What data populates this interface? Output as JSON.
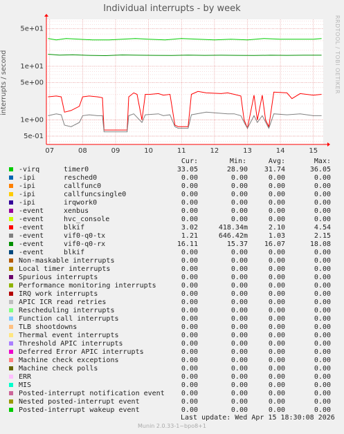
{
  "title": "Individual interrupts - by week",
  "side_credit": "RRDTOOL / TOBI OETIKER",
  "ylabel": "interrupts / second",
  "colors": {
    "axis_red": "#ff0000",
    "grid": "#e8a0a0",
    "background": "#f0f0f0",
    "plot_bg": "#ffffff"
  },
  "headers": {
    "cur": "Cur:",
    "min": "Min:",
    "avg": "Avg:",
    "max": "Max:"
  },
  "legend": [
    {
      "type": "-virq",
      "name": "timer0",
      "color": "#00cc00",
      "cur": "33.05",
      "min": "28.90",
      "avg": "31.74",
      "max": "36.05"
    },
    {
      "type": "-ipi",
      "name": "resched0",
      "color": "#0066b3",
      "cur": "0.00",
      "min": "0.00",
      "avg": "0.00",
      "max": "0.00"
    },
    {
      "type": "-ipi",
      "name": "callfunc0",
      "color": "#ff8000",
      "cur": "0.00",
      "min": "0.00",
      "avg": "0.00",
      "max": "0.00"
    },
    {
      "type": "-ipi",
      "name": "callfuncsingle0",
      "color": "#ffcc00",
      "cur": "0.00",
      "min": "0.00",
      "avg": "0.00",
      "max": "0.00"
    },
    {
      "type": "-ipi",
      "name": "irqwork0",
      "color": "#330099",
      "cur": "0.00",
      "min": "0.00",
      "avg": "0.00",
      "max": "0.00"
    },
    {
      "type": "-event",
      "name": "xenbus",
      "color": "#990099",
      "cur": "0.00",
      "min": "0.00",
      "avg": "0.00",
      "max": "0.00"
    },
    {
      "type": "-event",
      "name": "hvc_console",
      "color": "#ccff00",
      "cur": "0.00",
      "min": "0.00",
      "avg": "0.00",
      "max": "0.00"
    },
    {
      "type": "-event",
      "name": "blkif",
      "color": "#ff0000",
      "cur": "3.02",
      "min": "418.34m",
      "avg": "2.10",
      "max": "4.54"
    },
    {
      "type": "-event",
      "name": "vif0-q0-tx",
      "color": "#808080",
      "cur": "1.21",
      "min": "646.42m",
      "avg": "1.03",
      "max": "2.15"
    },
    {
      "type": "-event",
      "name": "vif0-q0-rx",
      "color": "#008f00",
      "cur": "16.11",
      "min": "15.37",
      "avg": "16.07",
      "max": "18.08"
    },
    {
      "type": "-event",
      "name": "blkif",
      "color": "#00487d",
      "cur": "0.00",
      "min": "0.00",
      "avg": "0.00",
      "max": "0.00"
    },
    {
      "type": "",
      "name": "Non-maskable interrupts",
      "color": "#b35a00",
      "cur": "0.00",
      "min": "0.00",
      "avg": "0.00",
      "max": "0.00"
    },
    {
      "type": "",
      "name": "Local timer interrupts",
      "color": "#b38f00",
      "cur": "0.00",
      "min": "0.00",
      "avg": "0.00",
      "max": "0.00"
    },
    {
      "type": "",
      "name": "Spurious interrupts",
      "color": "#6b006b",
      "cur": "0.00",
      "min": "0.00",
      "avg": "0.00",
      "max": "0.00"
    },
    {
      "type": "",
      "name": "Performance monitoring interrupts",
      "color": "#8fb300",
      "cur": "0.00",
      "min": "0.00",
      "avg": "0.00",
      "max": "0.00"
    },
    {
      "type": "",
      "name": "IRQ work interrupts",
      "color": "#b30000",
      "cur": "0.00",
      "min": "0.00",
      "avg": "0.00",
      "max": "0.00"
    },
    {
      "type": "",
      "name": "APIC ICR read retries",
      "color": "#bebebe",
      "cur": "0.00",
      "min": "0.00",
      "avg": "0.00",
      "max": "0.00"
    },
    {
      "type": "",
      "name": "Rescheduling interrupts",
      "color": "#80ff80",
      "cur": "0.00",
      "min": "0.00",
      "avg": "0.00",
      "max": "0.00"
    },
    {
      "type": "",
      "name": "Function call interrupts",
      "color": "#80c9ff",
      "cur": "0.00",
      "min": "0.00",
      "avg": "0.00",
      "max": "0.00"
    },
    {
      "type": "",
      "name": "TLB shootdowns",
      "color": "#ffc080",
      "cur": "0.00",
      "min": "0.00",
      "avg": "0.00",
      "max": "0.00"
    },
    {
      "type": "",
      "name": "Thermal event interrupts",
      "color": "#ffe680",
      "cur": "0.00",
      "min": "0.00",
      "avg": "0.00",
      "max": "0.00"
    },
    {
      "type": "",
      "name": "Threshold APIC interrupts",
      "color": "#aa80ff",
      "cur": "0.00",
      "min": "0.00",
      "avg": "0.00",
      "max": "0.00"
    },
    {
      "type": "",
      "name": "Deferred Error APIC interrupts",
      "color": "#ee00cc",
      "cur": "0.00",
      "min": "0.00",
      "avg": "0.00",
      "max": "0.00"
    },
    {
      "type": "",
      "name": "Machine check exceptions",
      "color": "#ff8080",
      "cur": "0.00",
      "min": "0.00",
      "avg": "0.00",
      "max": "0.00"
    },
    {
      "type": "",
      "name": "Machine check polls",
      "color": "#666600",
      "cur": "0.00",
      "min": "0.00",
      "avg": "0.00",
      "max": "0.00"
    },
    {
      "type": "",
      "name": "ERR",
      "color": "#ffbfff",
      "cur": "0.00",
      "min": "0.00",
      "avg": "0.00",
      "max": "0.00"
    },
    {
      "type": "",
      "name": "MIS",
      "color": "#00ffcc",
      "cur": "0.00",
      "min": "0.00",
      "avg": "0.00",
      "max": "0.00"
    },
    {
      "type": "",
      "name": "Posted-interrupt notification event",
      "color": "#cc6699",
      "cur": "0.00",
      "min": "0.00",
      "avg": "0.00",
      "max": "0.00"
    },
    {
      "type": "",
      "name": "Nested posted-interrupt event",
      "color": "#999900",
      "cur": "0.00",
      "min": "0.00",
      "avg": "0.00",
      "max": "0.00"
    },
    {
      "type": "",
      "name": "Posted-interrupt wakeup event",
      "color": "#00cc00",
      "cur": "0.00",
      "min": "0.00",
      "avg": "0.00",
      "max": "0.00"
    }
  ],
  "last_update": "Last update: Wed Apr 15 18:30:08 2026",
  "munin_version": "Munin 2.0.33-1~bpo8+1",
  "chart_data": {
    "type": "line",
    "yscale": "log",
    "ylim": [
      0.35,
      75
    ],
    "xlim": [
      6.9,
      15.3
    ],
    "xlabel": "",
    "ylabel": "interrupts / second",
    "x_ticks": [
      7,
      8,
      9,
      10,
      11,
      12,
      13,
      14,
      15
    ],
    "x_tick_labels": [
      "07",
      "08",
      "09",
      "10",
      "11",
      "12",
      "13",
      "14",
      "15"
    ],
    "y_ticks": [
      0.5,
      1,
      5,
      10,
      50
    ],
    "y_tick_labels": [
      "5e-01",
      "1e+00",
      "5e+00",
      "1e+01",
      "5e+01"
    ],
    "series": [
      {
        "name": "timer0",
        "color": "#00cc00",
        "x": [
          6.95,
          7.2,
          7.5,
          7.9,
          8.3,
          8.8,
          9.2,
          9.6,
          10.0,
          10.5,
          11.0,
          11.5,
          12.0,
          12.5,
          13.0,
          13.5,
          14.0,
          14.5,
          15.0,
          15.25
        ],
        "values": [
          33,
          31,
          33,
          32,
          31,
          31,
          32,
          33,
          32,
          31,
          33,
          32,
          31,
          32,
          31,
          33,
          32,
          32,
          32,
          33
        ]
      },
      {
        "name": "vif0-q0-rx",
        "color": "#008f00",
        "x": [
          6.95,
          7.3,
          7.7,
          8.2,
          8.7,
          9.2,
          9.7,
          10.2,
          10.7,
          11.2,
          11.7,
          12.2,
          12.7,
          13.2,
          13.7,
          14.2,
          14.7,
          15.25
        ],
        "values": [
          16.8,
          16.2,
          16.4,
          16.0,
          15.8,
          16.3,
          16.1,
          16.0,
          15.9,
          16.2,
          16.0,
          16.1,
          16.0,
          15.9,
          16.1,
          16.0,
          16.1,
          16.1
        ]
      },
      {
        "name": "blkif",
        "color": "#ff0000",
        "x": [
          6.95,
          7.2,
          7.35,
          7.45,
          7.65,
          7.9,
          8.0,
          8.2,
          8.45,
          8.6,
          8.65,
          9.35,
          9.4,
          9.55,
          9.65,
          9.8,
          9.9,
          10.05,
          10.3,
          10.45,
          10.65,
          10.8,
          10.9,
          11.2,
          11.3,
          11.5,
          11.75,
          12.2,
          12.4,
          12.6,
          12.8,
          12.9,
          13.0,
          13.2,
          13.3,
          13.45,
          13.55,
          13.65,
          13.8,
          14.2,
          14.35,
          14.6,
          15.0,
          15.25
        ],
        "values": [
          2.7,
          2.8,
          2.7,
          1.4,
          1.5,
          1.8,
          2.7,
          2.8,
          2.7,
          2.6,
          0.65,
          0.65,
          2.7,
          3.2,
          3.0,
          1.0,
          3.0,
          3.0,
          3.1,
          2.9,
          3.0,
          0.8,
          0.75,
          0.75,
          3.0,
          3.4,
          3.2,
          3.1,
          3.2,
          3.0,
          2.8,
          1.0,
          0.7,
          2.9,
          1.0,
          2.9,
          1.0,
          0.75,
          3.3,
          3.2,
          2.5,
          3.1,
          2.9,
          3.0
        ]
      },
      {
        "name": "vif0-q0-tx",
        "color": "#808080",
        "x": [
          6.95,
          7.2,
          7.35,
          7.45,
          7.65,
          7.9,
          8.0,
          8.2,
          8.45,
          8.6,
          8.65,
          9.35,
          9.4,
          9.55,
          9.8,
          9.9,
          10.3,
          10.45,
          10.65,
          10.8,
          10.9,
          11.2,
          11.3,
          11.75,
          12.4,
          12.6,
          12.8,
          12.9,
          13.0,
          13.2,
          13.3,
          13.45,
          13.65,
          13.8,
          14.2,
          14.6,
          15.0,
          15.25
        ],
        "values": [
          1.2,
          1.3,
          1.25,
          0.8,
          0.75,
          0.9,
          1.2,
          1.25,
          1.2,
          1.2,
          0.6,
          0.6,
          1.2,
          1.3,
          0.9,
          1.25,
          1.3,
          1.2,
          1.25,
          0.75,
          0.7,
          0.7,
          1.25,
          1.4,
          1.3,
          1.3,
          1.2,
          0.9,
          0.7,
          1.2,
          0.9,
          1.2,
          0.7,
          1.3,
          1.25,
          1.3,
          1.2,
          1.2
        ]
      }
    ]
  }
}
